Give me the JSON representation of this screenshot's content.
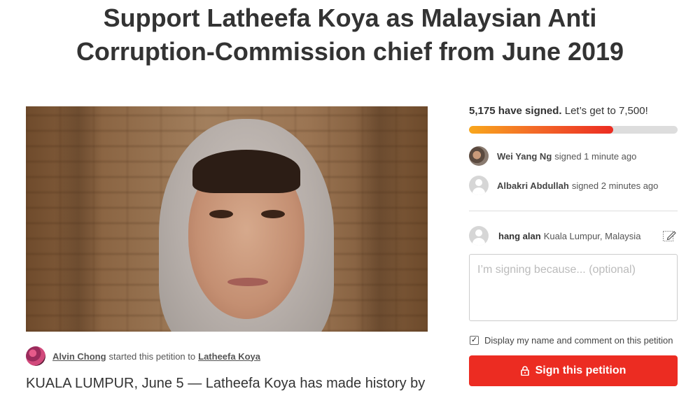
{
  "petition": {
    "title_line1": "Support Latheefa Koya as Malaysian Anti",
    "title_line2": "Corruption-Commission chief from June 2019",
    "starter_name": "Alvin Chong",
    "starter_mid": "started this petition to",
    "target_name": "Latheefa Koya",
    "lead_text": "KUALA LUMPUR, June 5 — Latheefa Koya has made history by"
  },
  "signatures": {
    "count_text": "5,175 have signed.",
    "goal_text": "Let’s get to 7,500!",
    "progress_fraction": 0.69,
    "recent": [
      {
        "name": "Wei Yang Ng",
        "time": "signed 1 minute ago",
        "avatar": "photo"
      },
      {
        "name": "Albakri Abdullah",
        "time": "signed 2 minutes ago",
        "avatar": "default"
      }
    ]
  },
  "sign_form": {
    "user_name": "hang alan",
    "user_location": "Kuala Lumpur, Malaysia",
    "edit_icon": "edit-icon",
    "reason_placeholder": "I’m signing because... (optional)",
    "display_label": "Display my name and comment on this petition",
    "display_checked": true,
    "button_label": "Sign this petition",
    "button_icon": "lock-icon"
  },
  "colors": {
    "accent": "#ec2c22",
    "progress_start": "#f8a71c",
    "progress_end": "#ec2c22"
  }
}
